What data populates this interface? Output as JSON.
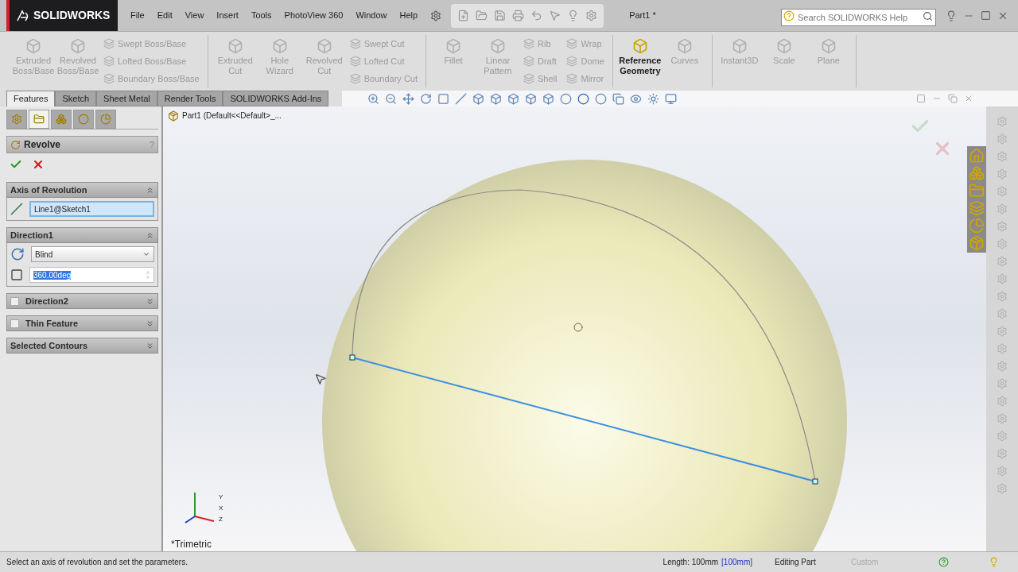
{
  "app": {
    "logo": "SOLIDWORKS",
    "document_title": "Part1 *",
    "search": {
      "placeholder": "Search SOLIDWORKS Help"
    }
  },
  "menu": [
    "File",
    "Edit",
    "View",
    "Insert",
    "Tools",
    "PhotoView 360",
    "Window",
    "Help"
  ],
  "ribbon": {
    "groups": [
      {
        "items": [
          {
            "label": "Extruded Boss/Base",
            "kind": "large",
            "disabled": true
          },
          {
            "label": "Revolved Boss/Base",
            "kind": "large",
            "disabled": true
          },
          {
            "label": "Swept Boss/Base",
            "kind": "small",
            "disabled": true
          },
          {
            "label": "Lofted Boss/Base",
            "kind": "small",
            "disabled": true
          },
          {
            "label": "Boundary Boss/Base",
            "kind": "small",
            "disabled": true
          }
        ]
      },
      {
        "items": [
          {
            "label": "Extruded Cut",
            "kind": "large",
            "disabled": true
          },
          {
            "label": "Hole Wizard",
            "kind": "large",
            "disabled": true
          },
          {
            "label": "Revolved Cut",
            "kind": "large",
            "disabled": true
          },
          {
            "label": "Swept Cut",
            "kind": "small",
            "disabled": true
          },
          {
            "label": "Lofted Cut",
            "kind": "small",
            "disabled": true
          },
          {
            "label": "Boundary Cut",
            "kind": "small",
            "disabled": true
          }
        ]
      },
      {
        "items": [
          {
            "label": "Fillet",
            "kind": "large",
            "disabled": true
          },
          {
            "label": "Linear Pattern",
            "kind": "large",
            "disabled": true
          },
          {
            "label": "Rib",
            "kind": "small",
            "disabled": true
          },
          {
            "label": "Draft",
            "kind": "small",
            "disabled": true
          },
          {
            "label": "Shell",
            "kind": "small",
            "disabled": true
          },
          {
            "label": "Wrap",
            "kind": "small",
            "disabled": true
          },
          {
            "label": "Dome",
            "kind": "small",
            "disabled": true
          },
          {
            "label": "Mirror",
            "kind": "small",
            "disabled": true
          }
        ]
      },
      {
        "items": [
          {
            "label": "Reference Geometry",
            "kind": "large",
            "disabled": false
          },
          {
            "label": "Curves",
            "kind": "large",
            "disabled": true
          }
        ]
      },
      {
        "items": [
          {
            "label": "Instant3D",
            "kind": "large",
            "disabled": true
          },
          {
            "label": "Scale",
            "kind": "large",
            "disabled": true
          },
          {
            "label": "Plane",
            "kind": "large",
            "disabled": true
          }
        ]
      }
    ]
  },
  "command_tabs": [
    {
      "label": "Features",
      "selected": true
    },
    {
      "label": "Sketch",
      "selected": false
    },
    {
      "label": "Sheet Metal",
      "selected": false
    },
    {
      "label": "Render Tools",
      "selected": false
    },
    {
      "label": "SOLIDWORKS Add-Ins",
      "selected": false
    }
  ],
  "panel_tabs": [
    {
      "selected": false
    },
    {
      "selected": true
    },
    {
      "selected": false
    },
    {
      "selected": false
    },
    {
      "selected": false
    }
  ],
  "property_manager": {
    "title": "Revolve",
    "help": "?",
    "sections": [
      {
        "kind": "axis",
        "title": "Axis of Revolution",
        "expanded": true,
        "value": "Line1@Sketch1"
      },
      {
        "kind": "direction",
        "title": "Direction1",
        "expanded": true,
        "type": "Blind",
        "angle": "360.00deg"
      },
      {
        "kind": "check",
        "title": "Direction2",
        "expanded": false,
        "checked": false
      },
      {
        "kind": "check",
        "title": "Thin Feature",
        "expanded": false,
        "checked": false
      },
      {
        "kind": "plain",
        "title": "Selected Contours",
        "expanded": false
      }
    ]
  },
  "feature_tree": {
    "label": "Part1  (Default<<Default>_..."
  },
  "viewport": {
    "view_name": "*Trimetric",
    "triad": [
      "Y",
      "X",
      "Z"
    ]
  },
  "status_bar": {
    "message": "Select an axis of revolution and set the parameters.",
    "length": "Length: 100mm",
    "length_bracket": "[100mm]",
    "mode": "Editing Part",
    "units": "Custom"
  }
}
